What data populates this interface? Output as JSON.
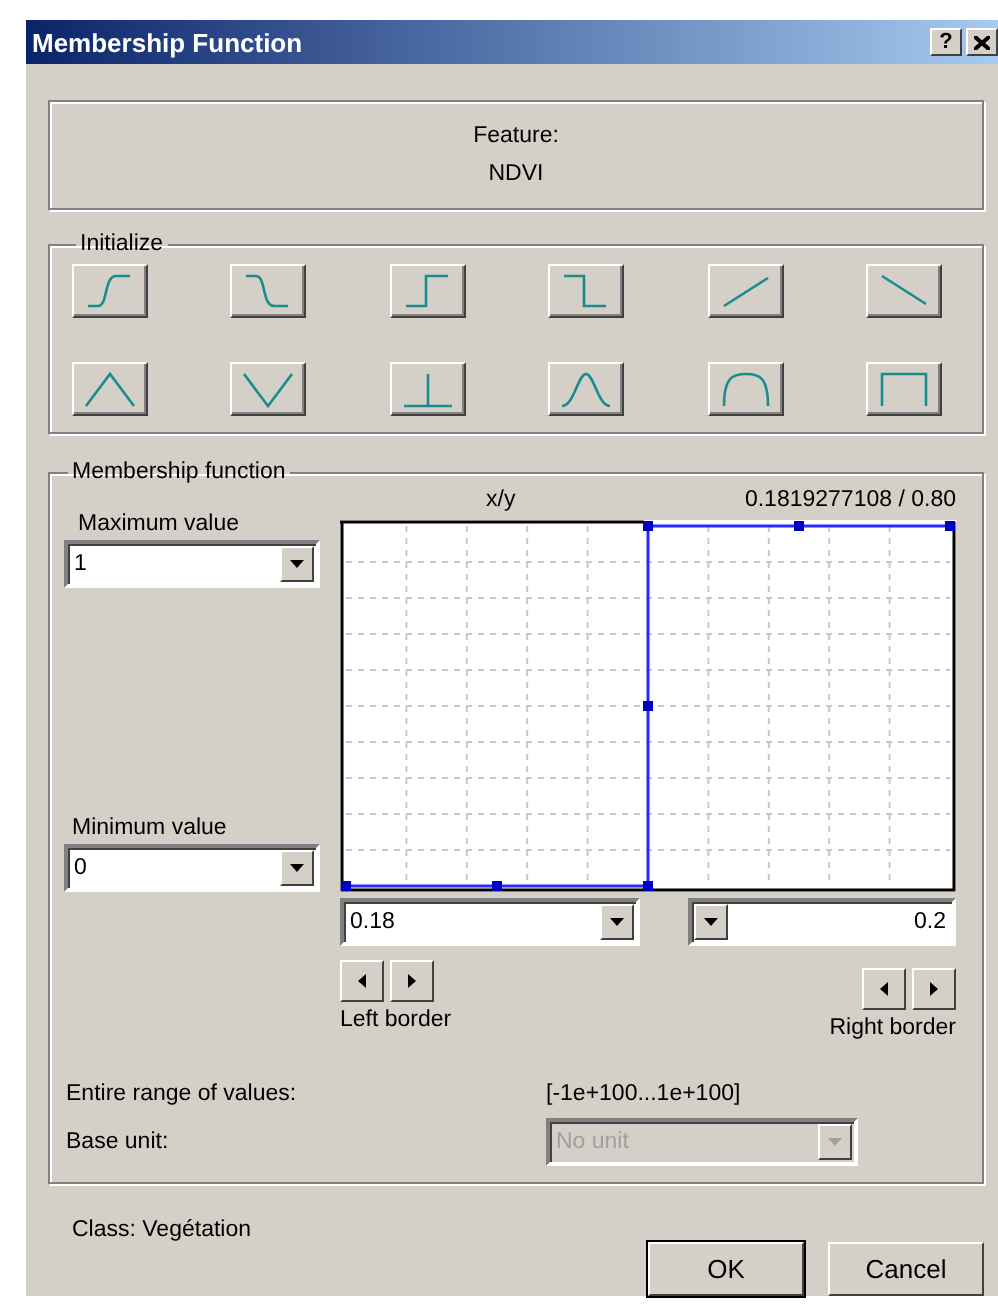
{
  "window": {
    "title": "Membership Function",
    "help_button": "?"
  },
  "feature": {
    "label": "Feature:",
    "value": "NDVI"
  },
  "initialize": {
    "title": "Initialize",
    "shapes": [
      {
        "kind": "s-rise"
      },
      {
        "kind": "s-fall"
      },
      {
        "kind": "step-up"
      },
      {
        "kind": "step-down"
      },
      {
        "kind": "ramp-up"
      },
      {
        "kind": "ramp-down"
      },
      {
        "kind": "triangle"
      },
      {
        "kind": "v-shape"
      },
      {
        "kind": "spike"
      },
      {
        "kind": "bell"
      },
      {
        "kind": "plateau"
      },
      {
        "kind": "rectangle"
      }
    ]
  },
  "membership": {
    "title": "Membership function",
    "max_label": "Maximum value",
    "max_value": "1",
    "min_label": "Minimum value",
    "min_value": "0",
    "axis_label": "x/y",
    "reading": "0.1819277108 / 0.80",
    "left_value": "0.18",
    "right_value": "0.2",
    "left_border_label": "Left border",
    "right_border_label": "Right border",
    "range_label": "Entire range of values:",
    "range_value": "[-1e+100...1e+100]",
    "base_unit_label": "Base unit:",
    "base_unit": {
      "value": "No unit",
      "disabled": true
    }
  },
  "class_label": "Class: Vegétation",
  "buttons": [
    {
      "label": "OK",
      "default": true
    },
    {
      "label": "Cancel",
      "default": false
    }
  ]
}
